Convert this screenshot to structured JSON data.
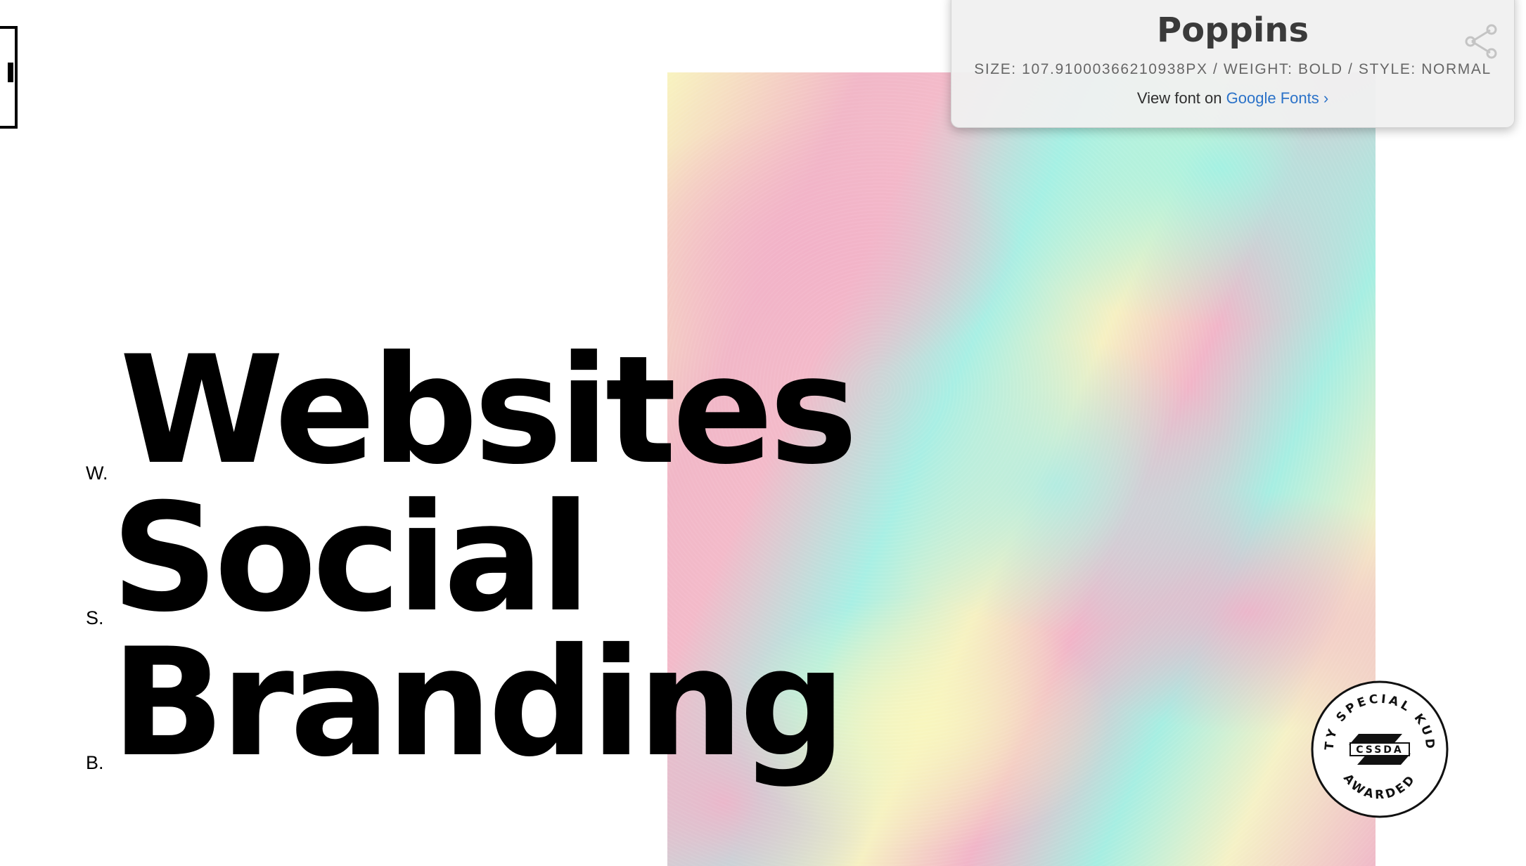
{
  "headline": {
    "rows": [
      {
        "letter": "W.",
        "word": "Websites"
      },
      {
        "letter": "S.",
        "word": "Social"
      },
      {
        "letter": "B.",
        "word": "Branding"
      }
    ]
  },
  "font_popover": {
    "font_name": "Poppins",
    "meta": "SIZE: 107.91000366210938PX / WEIGHT: BOLD / STYLE: NORMAL",
    "view_prefix": "View font on",
    "view_link": "Google Fonts ›",
    "share_icon": "share-icon"
  },
  "badge": {
    "top_text": "DOTY SPECIAL KUDOS",
    "center_text": "CSSDA",
    "bottom_text": "AWARDED"
  },
  "colors": {
    "text": "#000000",
    "link": "#2b72c8",
    "holo_pink": "#f1b7c7",
    "holo_mint": "#a8efe4",
    "holo_yellow": "#f8f3bf"
  }
}
